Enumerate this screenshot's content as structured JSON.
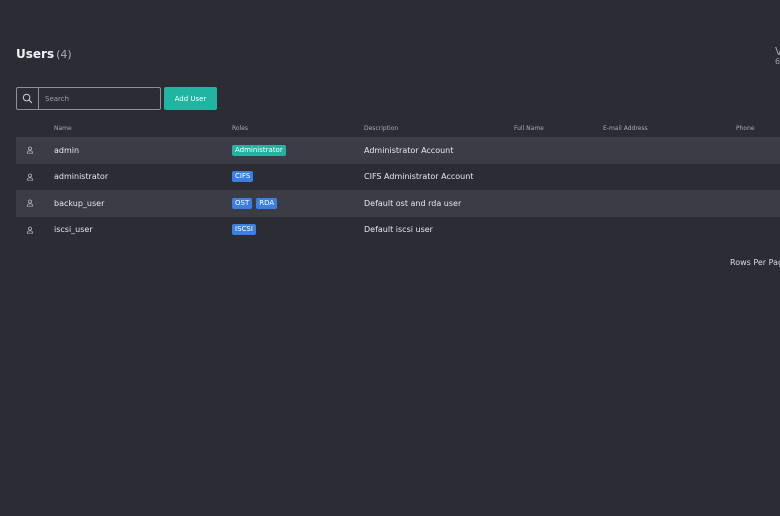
{
  "header": {
    "title": "Users",
    "count": "(4)",
    "right_clip_line1": "V",
    "right_clip_line2": "6"
  },
  "toolbar": {
    "search_placeholder": "Search",
    "search_value": "",
    "add_user_label": "Add User"
  },
  "table": {
    "columns": {
      "name": "Name",
      "roles": "Roles",
      "description": "Description",
      "full_name": "Full Name",
      "email": "E-mail Address",
      "phone": "Phone"
    },
    "rows": [
      {
        "icon": "user-icon",
        "name": "admin",
        "roles": [
          {
            "label": "Administrator",
            "color": "#1fb5a0"
          }
        ],
        "description": "Administrator Account",
        "full_name": "",
        "email": "",
        "phone": ""
      },
      {
        "icon": "user-icon",
        "name": "administrator",
        "roles": [
          {
            "label": "CIFS",
            "color": "#3d7fe0"
          }
        ],
        "description": "CIFS Administrator Account",
        "full_name": "",
        "email": "",
        "phone": ""
      },
      {
        "icon": "user-icon",
        "name": "backup_user",
        "roles": [
          {
            "label": "OST",
            "color": "#3d7fe0"
          },
          {
            "label": "RDA",
            "color": "#3d7fe0"
          }
        ],
        "description": "Default ost and rda user",
        "full_name": "",
        "email": "",
        "phone": ""
      },
      {
        "icon": "user-icon",
        "name": "iscsi_user",
        "roles": [
          {
            "label": "ISCSI",
            "color": "#3d7fe0"
          }
        ],
        "description": "Default iscsi user",
        "full_name": "",
        "email": "",
        "phone": ""
      }
    ]
  },
  "pagination": {
    "rows_per_page_label": "Rows Per Pag"
  },
  "colors": {
    "background": "#2b2c34",
    "row_shaded": "#3b3c45",
    "accent_teal": "#1fb5a0",
    "badge_blue": "#3d7fe0"
  }
}
